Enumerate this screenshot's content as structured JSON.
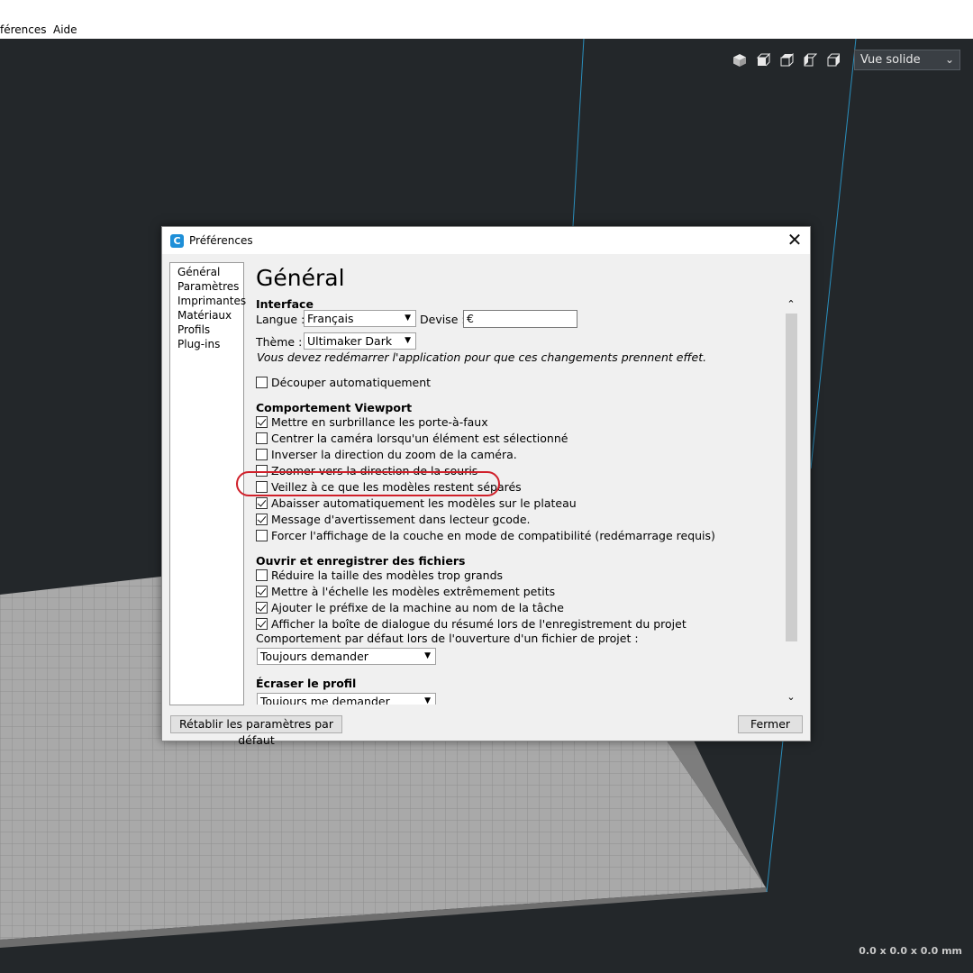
{
  "menu": {
    "items": [
      "férences",
      "Aide"
    ]
  },
  "toolbar": {
    "view_icons": [
      "cube-3d-icon",
      "front-view-icon",
      "top-view-icon",
      "left-view-icon",
      "right-view-icon"
    ],
    "view_mode": "Vue solide"
  },
  "status": {
    "dimensions": "0.0 x 0.0 x 0.0 mm"
  },
  "dialog": {
    "title": "Préférences",
    "nav": [
      "Général",
      "Paramètres",
      "Imprimantes",
      "Matériaux",
      "Profils",
      "Plug-ins"
    ],
    "heading": "Général",
    "interface": {
      "section": "Interface",
      "language_label": "Langue :",
      "language_value": "Français",
      "currency_label": "Devise :",
      "currency_value": "€",
      "theme_label": "Thème :",
      "theme_value": "Ultimaker Dark",
      "restart_note": "Vous devez redémarrer l'application pour que ces changements prennent effet.",
      "auto_slice": {
        "label": "Découper automatiquement",
        "checked": false
      }
    },
    "viewport": {
      "section": "Comportement Viewport",
      "options": [
        {
          "label": "Mettre en surbrillance les porte-à-faux",
          "checked": true
        },
        {
          "label": "Centrer la caméra lorsqu'un élément est sélectionné",
          "checked": false
        },
        {
          "label": "Inverser la direction du zoom de la caméra.",
          "checked": false
        },
        {
          "label": "Zoomer vers la direction de la souris",
          "checked": false
        },
        {
          "label": "Veillez à ce que les modèles restent séparés",
          "checked": false
        },
        {
          "label": "Abaisser automatiquement les modèles sur le plateau",
          "checked": true
        },
        {
          "label": "Message d'avertissement dans lecteur gcode.",
          "checked": true
        },
        {
          "label": "Forcer l'affichage de la couche en mode de compatibilité (redémarrage requis)",
          "checked": false
        }
      ]
    },
    "files": {
      "section": "Ouvrir et enregistrer des fichiers",
      "options": [
        {
          "label": "Réduire la taille des modèles trop grands",
          "checked": false
        },
        {
          "label": "Mettre à l'échelle les modèles extrêmement petits",
          "checked": true
        },
        {
          "label": "Ajouter le préfixe de la machine au nom de la tâche",
          "checked": true
        },
        {
          "label": "Afficher la boîte de dialogue du résumé lors de l'enregistrement du projet",
          "checked": true
        }
      ],
      "project_behavior_label": "Comportement par défaut lors de l'ouverture d'un fichier de projet :",
      "project_behavior_value": "Toujours demander"
    },
    "profile": {
      "section": "Écraser le profil",
      "value": "Toujours me demander"
    },
    "reset_button": "Rétablir les paramètres par défaut",
    "close_button": "Fermer"
  },
  "colors": {
    "highlight": "#d0202a",
    "viewport_bg": "#23272a",
    "build_line": "#2a8fbd"
  }
}
